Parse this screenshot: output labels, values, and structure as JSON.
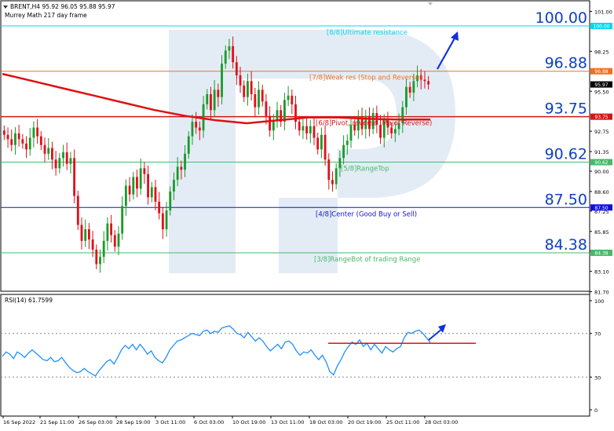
{
  "header": {
    "symbol_line": "BRENT,H4  95.92 96.05 95.88 95.97",
    "indicator_line": "Murrey Math 217 day frame"
  },
  "chart_data": {
    "type": "candlestick",
    "symbol": "BRENT",
    "timeframe": "H4",
    "ohlc_last": {
      "open": 95.92,
      "high": 96.05,
      "low": 95.88,
      "close": 95.97
    },
    "ylim": [
      81.2,
      101.8
    ],
    "y_ticks": [
      "101.00",
      "98.25",
      "95.50",
      "92.75",
      "91.35",
      "90.00",
      "88.60",
      "87.25",
      "85.85",
      "84.50",
      "83.10",
      "81.70"
    ],
    "x_ticks": [
      "16 Sep 2022",
      "21 Sep 11:00",
      "26 Sep 03:00",
      "28 Sep 19:00",
      "3 Oct 11:00",
      "6 Oct 03:00",
      "10 Oct 19:00",
      "13 Oct 11:00",
      "18 Oct 03:00",
      "20 Oct 19:00",
      "25 Oct 11:00",
      "28 Oct 03:00"
    ],
    "murrey_levels": [
      {
        "value": 100.0,
        "value_label": "100.00",
        "tag": "100.00",
        "label": "[8/8]Ultimate resistance",
        "color": "#00d8f0"
      },
      {
        "value": 96.88,
        "value_label": "96.88",
        "tag": "96.88",
        "label": "[7/8]Weak res (Stop and Reverse)",
        "color": "#f07020"
      },
      {
        "value": 93.75,
        "value_label": "93.75",
        "tag": "93.75",
        "label": "[6/8]Pivot, reverse (Major Reverse)",
        "color": "#d01818"
      },
      {
        "value": 90.62,
        "value_label": "90.62",
        "tag": "90.62",
        "label": "[5/8]RangeTop",
        "color": "#4ab86a"
      },
      {
        "value": 87.5,
        "value_label": "87.50",
        "tag": "87.50",
        "label": "[4/8]Center (Good Buy or Sell)",
        "color": "#1010e0"
      },
      {
        "value": 84.38,
        "value_label": "84.38",
        "tag": "84.38",
        "label": "[3/8]RangeBot of trading Range",
        "color": "#4ab86a"
      }
    ],
    "current_price_tag": "95.97",
    "close_path": [
      92.5,
      92.2,
      91.8,
      92.6,
      92.2,
      91.9,
      91.5,
      92.3,
      93.0,
      92.4,
      91.8,
      91.2,
      91.6,
      90.8,
      90.2,
      90.9,
      91.3,
      90.5,
      90.9,
      88.3,
      86.3,
      85.2,
      86.0,
      85.3,
      84.6,
      83.6,
      84.1,
      85.2,
      86.4,
      85.6,
      84.8,
      85.7,
      87.6,
      89.0,
      88.4,
      89.6,
      88.8,
      90.2,
      89.8,
      88.2,
      88.9,
      87.9,
      87.1,
      86.0,
      87.3,
      88.6,
      89.4,
      90.3,
      90.1,
      91.2,
      92.4,
      93.4,
      93.0,
      92.8,
      94.6,
      95.3,
      94.2,
      95.6,
      95.1,
      97.4,
      98.3,
      98.6,
      97.5,
      96.6,
      95.9,
      95.1,
      96.2,
      95.3,
      94.4,
      95.6,
      94.8,
      93.8,
      92.8,
      93.5,
      94.2,
      93.4,
      94.9,
      95.2,
      94.6,
      93.4,
      92.8,
      93.1,
      92.6,
      93.1,
      92.3,
      91.5,
      92.5,
      90.8,
      89.4,
      89.1,
      90.2,
      90.9,
      91.8,
      92.1,
      93.2,
      92.8,
      93.7,
      92.9,
      93.8,
      92.9,
      94.0,
      93.2,
      92.3,
      93.5,
      93.0,
      92.6,
      92.9,
      93.3,
      94.4,
      95.8,
      95.4,
      96.2,
      96.6,
      96.3,
      96.2,
      95.97
    ],
    "ma_label": "",
    "ma_path": [
      96.7,
      96.2,
      95.7,
      95.2,
      94.7,
      94.2,
      93.8,
      93.5,
      93.3,
      93.5,
      93.7,
      93.7,
      93.6,
      93.55,
      93.55
    ],
    "rsi": {
      "label": "RSI(14) 61.7599",
      "ylim": [
        0,
        100
      ],
      "levels": [
        70,
        30
      ],
      "y_ticks": [
        "100",
        "70",
        "30",
        "0"
      ],
      "values": [
        49,
        53,
        51,
        47,
        53,
        51,
        48,
        52,
        55,
        52,
        49,
        46,
        45,
        48,
        44,
        45,
        48,
        43,
        39,
        36,
        34,
        35,
        38,
        35,
        33,
        31,
        36,
        40,
        44,
        46,
        42,
        48,
        55,
        59,
        56,
        60,
        55,
        60,
        56,
        51,
        54,
        48,
        45,
        43,
        48,
        55,
        59,
        63,
        64,
        66,
        68,
        70,
        69,
        68,
        72,
        73,
        70,
        72,
        71,
        75,
        76,
        77,
        74,
        70,
        69,
        66,
        71,
        67,
        63,
        66,
        63,
        58,
        54,
        57,
        60,
        56,
        62,
        63,
        60,
        54,
        50,
        53,
        52,
        55,
        50,
        46,
        50,
        44,
        35,
        32,
        40,
        46,
        53,
        58,
        62,
        60,
        64,
        58,
        61,
        55,
        60,
        56,
        52,
        58,
        55,
        53,
        56,
        58,
        66,
        71,
        70,
        72,
        73,
        70,
        66,
        61.76
      ],
      "support_line_value": 61
    }
  }
}
